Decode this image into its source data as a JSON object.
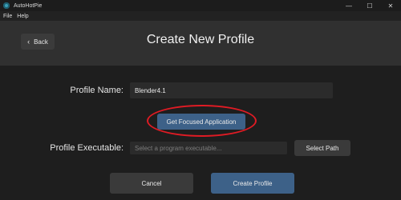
{
  "window": {
    "title": "AutoHotPie",
    "minimize": "—",
    "maximize": "☐",
    "close": "✕"
  },
  "menu": {
    "items": [
      "File",
      "Help"
    ]
  },
  "header": {
    "back_label": "Back",
    "back_icon": "‹",
    "title": "Create New Profile"
  },
  "form": {
    "profile_name_label": "Profile Name:",
    "profile_name_value": "Blender4.1",
    "get_focused_label": "Get Focused Application",
    "executable_label": "Profile Executable:",
    "executable_placeholder": "Select a program executable...",
    "select_path_label": "Select Path"
  },
  "footer": {
    "cancel_label": "Cancel",
    "create_label": "Create Profile"
  },
  "colors": {
    "accent": "#3d6188",
    "highlight": "#e01b24",
    "background": "#1e1e1e",
    "header": "#303030"
  }
}
